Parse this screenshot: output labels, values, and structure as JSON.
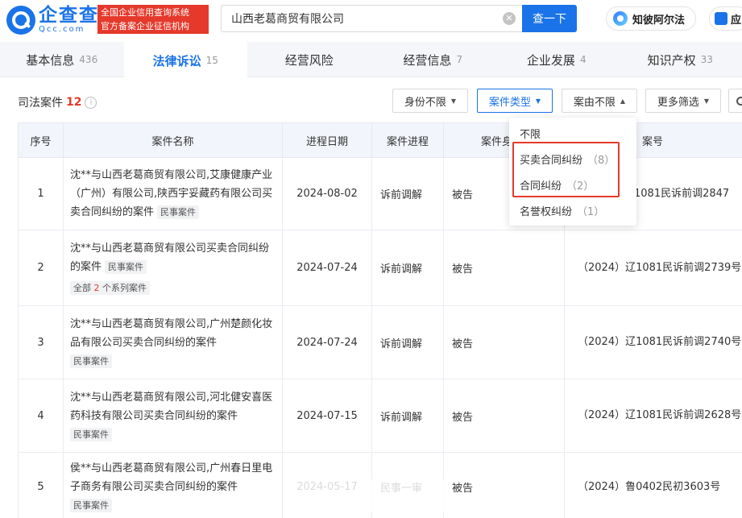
{
  "header": {
    "logo_cn": "企查查",
    "logo_en": "Qcc.com",
    "slogan_line1": "全国企业信用查询系统",
    "slogan_line2": "官方备案企业征信机构",
    "search_value": "山西老葛商贸有限公司",
    "search_button": "查一下",
    "zhibi_label": "知彼阿尔法",
    "app_label": "应"
  },
  "tabs": [
    {
      "label": "基本信息",
      "count": "436"
    },
    {
      "label": "法律诉讼",
      "count": "15"
    },
    {
      "label": "经营风险",
      "count": ""
    },
    {
      "label": "经营信息",
      "count": "7"
    },
    {
      "label": "企业发展",
      "count": "4"
    },
    {
      "label": "知识产权",
      "count": "33"
    }
  ],
  "section": {
    "title": "司法案件",
    "count": "12",
    "info": "i"
  },
  "filters": {
    "identity": "身份不限",
    "case_type": "案件类型",
    "cause": "案由不限",
    "more": "更多筛选"
  },
  "table": {
    "headers": [
      "序号",
      "案件名称",
      "进程日期",
      "案件进程",
      "案件身份",
      "案号"
    ],
    "header_case_identity_visible": "案件身",
    "rows": [
      {
        "idx": "1",
        "name": "沈**与山西老葛商贸有限公司,艾康健康产业（广州）有限公司,陕西宇妥藏药有限公司买卖合同纠纷的案件",
        "tag": "民事案件",
        "date": "2024-08-02",
        "progress": "诉前调解",
        "role": "被告",
        "case_no": "1081民诉前调2847"
      },
      {
        "idx": "2",
        "name": "沈**与山西老葛商贸有限公司买卖合同纠纷的案件",
        "tag": "民事案件",
        "series_prefix": "全部",
        "series_num": "2",
        "series_suffix": "个系列案件",
        "date": "2024-07-24",
        "progress": "诉前调解",
        "role": "被告",
        "case_no": "（2024）辽1081民诉前调2739号"
      },
      {
        "idx": "3",
        "name": "沈**与山西老葛商贸有限公司,广州楚颜化妆品有限公司买卖合同纠纷的案件",
        "tag": "民事案件",
        "date": "2024-07-24",
        "progress": "诉前调解",
        "role": "被告",
        "case_no": "（2024）辽1081民诉前调2740号"
      },
      {
        "idx": "4",
        "name": "沈**与山西老葛商贸有限公司,河北健安喜医药科技有限公司买卖合同纠纷的案件",
        "tag": "民事案件",
        "date": "2024-07-15",
        "progress": "诉前调解",
        "role": "被告",
        "case_no": "（2024）辽1081民诉前调2628号"
      },
      {
        "idx": "5",
        "name": "侯**与山西老葛商贸有限公司,广州春日里电子商务有限公司买卖合同纠纷的案件",
        "tag": "民事案件",
        "date": "2024-05-17",
        "progress": "民事一审",
        "role": "被告",
        "case_no": "（2024）鲁0402民初3603号"
      }
    ]
  },
  "dropdown": {
    "items": [
      {
        "label": "不限",
        "count": ""
      },
      {
        "label": "买卖合同纠纷",
        "count": "（8）"
      },
      {
        "label": "合同纠纷",
        "count": "（2）"
      },
      {
        "label": "名誉权纠纷",
        "count": "（1）"
      }
    ]
  },
  "colors": {
    "brand": "#1a73e8",
    "highlight": "#e5392b"
  }
}
